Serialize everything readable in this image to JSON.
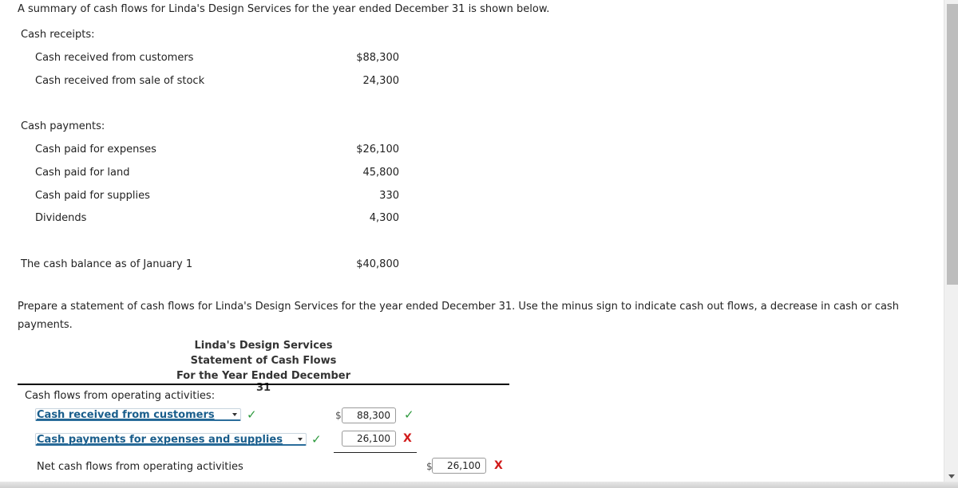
{
  "intro": "A summary of cash flows for Linda's Design Services for the year ended December 31 is shown below.",
  "summary": {
    "receipts_label": "Cash receipts:",
    "receipts": [
      {
        "label": "Cash received from customers",
        "value": "$88,300"
      },
      {
        "label": "Cash received from sale of stock",
        "value": "24,300"
      }
    ],
    "payments_label": "Cash payments:",
    "payments": [
      {
        "label": "Cash paid for expenses",
        "value": "$26,100"
      },
      {
        "label": "Cash paid for land",
        "value": "45,800"
      },
      {
        "label": "Cash paid for supplies",
        "value": "330"
      },
      {
        "label": "Dividends",
        "value": "4,300"
      }
    ],
    "opening_balance": {
      "label": "The cash balance as of January 1",
      "value": "$40,800"
    }
  },
  "instructions": {
    "line1": "Prepare a statement of cash flows for Linda's Design Services for the year ended December 31. Use the minus sign to indicate cash out flows, a decrease in cash or cash",
    "line2": "payments."
  },
  "statement": {
    "company": "Linda's Design Services",
    "title": "Statement of Cash Flows",
    "period": "For the Year Ended December 31",
    "section_operating": "Cash flows from operating activities:",
    "rows": [
      {
        "dropdown": "Cash received from customers",
        "dropdown_status": "correct",
        "currency": "$",
        "value": "88,300",
        "value_status": "correct"
      },
      {
        "dropdown": "Cash payments for expenses and supplies",
        "dropdown_status": "correct",
        "currency": "",
        "value": "26,100",
        "value_status": "incorrect"
      }
    ],
    "net_operating": {
      "label": "Net cash flows from operating activities",
      "currency": "$",
      "value": "26,100",
      "value_status": "incorrect"
    }
  },
  "icons": {
    "check": "✓",
    "cross": "X"
  },
  "colors": {
    "correct": "#2e9a3e",
    "incorrect": "#d11a1a",
    "link": "#1a5e8c"
  }
}
